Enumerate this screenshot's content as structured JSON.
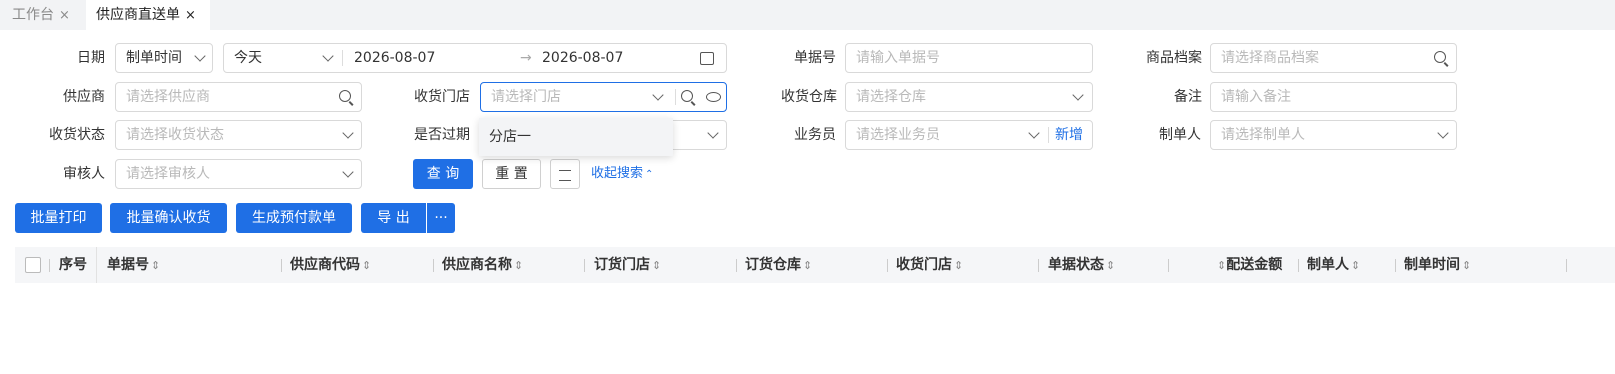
{
  "tabs": [
    {
      "label": "工作台",
      "close": "×"
    },
    {
      "label": "供应商直送单",
      "close": "×"
    }
  ],
  "filters": {
    "date_label": "日期",
    "date_type_value": "制单时间",
    "date_range_value": "今天",
    "date_start": "2026-08-07",
    "date_arrow": "→",
    "date_end": "2026-08-07",
    "doc_no_label": "单据号",
    "doc_no_placeholder": "请输入单据号",
    "goods_label": "商品档案",
    "goods_placeholder": "请选择商品档案",
    "supplier_label": "供应商",
    "supplier_placeholder": "请选择供应商",
    "store_label": "收货门店",
    "store_placeholder": "请选择门店",
    "warehouse_label": "收货仓库",
    "warehouse_placeholder": "请选择仓库",
    "remark_label": "备注",
    "remark_placeholder": "请输入备注",
    "receive_status_label": "收货状态",
    "receive_status_placeholder": "请选择收货状态",
    "expired_label": "是否过期",
    "salesman_label": "业务员",
    "salesman_placeholder": "请选择业务员",
    "salesman_add": "新增",
    "creator_label": "制单人",
    "creator_placeholder": "请选择制单人",
    "auditor_label": "审核人",
    "auditor_placeholder": "请选择审核人"
  },
  "buttons": {
    "query": "查 询",
    "reset": "重 置",
    "collapse": "收起搜索"
  },
  "store_dropdown": {
    "options": [
      "分店一"
    ]
  },
  "actions": {
    "batch_print": "批量打印",
    "batch_confirm": "批量确认收货",
    "generate_prepay": "生成预付款单",
    "export": "导 出",
    "more": "···"
  },
  "table": {
    "columns": [
      "序号",
      "单据号",
      "供应商代码",
      "供应商名称",
      "订货门店",
      "订货仓库",
      "收货门店",
      "单据状态",
      "配送金额",
      "制单人",
      "制单时间"
    ]
  },
  "colors": {
    "primary": "#1f6fe5",
    "link": "#1f6fe5"
  }
}
